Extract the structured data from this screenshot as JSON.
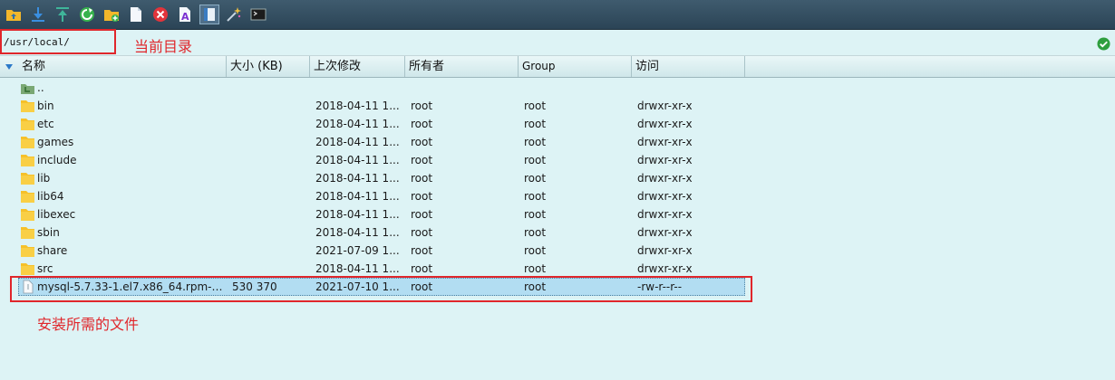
{
  "toolbar": {
    "buttons": [
      {
        "name": "parent-folder-icon"
      },
      {
        "name": "download-icon"
      },
      {
        "name": "upload-icon"
      },
      {
        "name": "refresh-icon"
      },
      {
        "name": "new-folder-icon"
      },
      {
        "name": "new-file-icon"
      },
      {
        "name": "delete-icon"
      },
      {
        "name": "rename-icon"
      },
      {
        "name": "properties-icon"
      },
      {
        "name": "wand-icon"
      },
      {
        "name": "terminal-icon"
      }
    ]
  },
  "path": {
    "value": "/usr/local/"
  },
  "columns": {
    "name": "名称",
    "size": "大小 (KB)",
    "modified": "上次修改",
    "owner": "所有者",
    "group": "Group",
    "access": "访问"
  },
  "files": [
    {
      "icon": "parent-dir",
      "name": "..",
      "size": "",
      "modified": "",
      "owner": "",
      "group": "",
      "access": ""
    },
    {
      "icon": "folder",
      "name": "bin",
      "size": "",
      "modified": "2018-04-11 1...",
      "owner": "root",
      "group": "root",
      "access": "drwxr-xr-x"
    },
    {
      "icon": "folder",
      "name": "etc",
      "size": "",
      "modified": "2018-04-11 1...",
      "owner": "root",
      "group": "root",
      "access": "drwxr-xr-x"
    },
    {
      "icon": "folder",
      "name": "games",
      "size": "",
      "modified": "2018-04-11 1...",
      "owner": "root",
      "group": "root",
      "access": "drwxr-xr-x"
    },
    {
      "icon": "folder",
      "name": "include",
      "size": "",
      "modified": "2018-04-11 1...",
      "owner": "root",
      "group": "root",
      "access": "drwxr-xr-x"
    },
    {
      "icon": "folder",
      "name": "lib",
      "size": "",
      "modified": "2018-04-11 1...",
      "owner": "root",
      "group": "root",
      "access": "drwxr-xr-x"
    },
    {
      "icon": "folder",
      "name": "lib64",
      "size": "",
      "modified": "2018-04-11 1...",
      "owner": "root",
      "group": "root",
      "access": "drwxr-xr-x"
    },
    {
      "icon": "folder",
      "name": "libexec",
      "size": "",
      "modified": "2018-04-11 1...",
      "owner": "root",
      "group": "root",
      "access": "drwxr-xr-x"
    },
    {
      "icon": "folder",
      "name": "sbin",
      "size": "",
      "modified": "2018-04-11 1...",
      "owner": "root",
      "group": "root",
      "access": "drwxr-xr-x"
    },
    {
      "icon": "folder",
      "name": "share",
      "size": "",
      "modified": "2021-07-09 1...",
      "owner": "root",
      "group": "root",
      "access": "drwxr-xr-x"
    },
    {
      "icon": "folder",
      "name": "src",
      "size": "",
      "modified": "2018-04-11 1...",
      "owner": "root",
      "group": "root",
      "access": "drwxr-xr-x"
    },
    {
      "icon": "file",
      "name": "mysql-5.7.33-1.el7.x86_64.rpm-b...",
      "size": "530 370",
      "modified": "2021-07-10 1...",
      "owner": "root",
      "group": "root",
      "access": "-rw-r--r--",
      "selected": true
    }
  ],
  "annotations": {
    "current_dir_label": "当前目录",
    "required_file_label": "安装所需的文件",
    "color": "#e0262b"
  },
  "colors": {
    "background": "#ddf3f5",
    "toolbar": "#2b4456",
    "selection": "#b2ddf2",
    "folder": "#f6c12a"
  }
}
